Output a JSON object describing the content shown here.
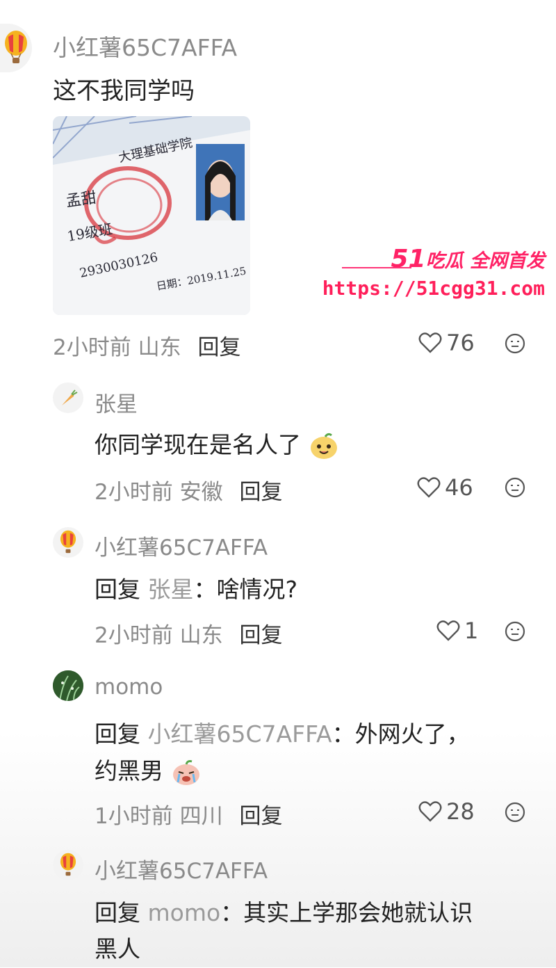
{
  "comments": [
    {
      "username": "小红薯65C7AFFA",
      "text": "这不我同学吗",
      "time": "2小时前",
      "location": "山东",
      "reply_label": "回复",
      "likes": "76"
    },
    {
      "username": "张星",
      "text": "你同学现在是名人了",
      "time": "2小时前",
      "location": "安徽",
      "reply_label": "回复",
      "likes": "46"
    },
    {
      "username": "小红薯65C7AFFA",
      "reply_kw": "回复",
      "mention": "张星",
      "text": "：啥情况?",
      "time": "2小时前",
      "location": "山东",
      "reply_label": "回复",
      "likes": "1"
    },
    {
      "username": "momo",
      "reply_kw": "回复",
      "mention": "小红薯65C7AFFA",
      "text": "：外网火了，",
      "text2": "约黑男",
      "time": "1小时前",
      "location": "四川",
      "reply_label": "回复",
      "likes": "28"
    },
    {
      "username": "小红薯65C7AFFA",
      "reply_kw": "回复",
      "mention": "momo",
      "text": "：其实上学那会她就认识",
      "text2": "黑人"
    }
  ],
  "watermark": {
    "brand_num": "51",
    "brand_text": "吃瓜 全网首发",
    "url": "https://51cgg31.com"
  },
  "photo": {
    "handwriting_1": "大理基础学院",
    "handwriting_2": "孟甜",
    "handwriting_3": "19级班",
    "handwriting_4": "2930030126",
    "handwriting_5": "日期：2019.11.25"
  },
  "colors": {
    "accent": "#ff2266",
    "text_primary": "#222222",
    "text_secondary": "#8a8a8a"
  }
}
